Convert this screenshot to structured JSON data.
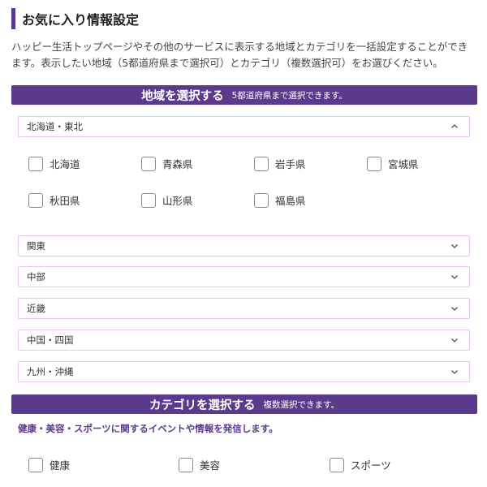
{
  "page": {
    "title": "お気に入り情報設定",
    "intro": "ハッピー生活トップページやその他のサービスに表示する地域とカテゴリを一括設定することができます。表示したい地域（5都道府県まで選択可）とカテゴリ（複数選択可）をお選びください。"
  },
  "region_section": {
    "title": "地域を選択する",
    "note": "5都道府県まで選択できます。"
  },
  "regions": {
    "hokkaido_tohoku": {
      "label": "北海道・東北",
      "expanded": true,
      "prefectures": [
        "北海道",
        "青森県",
        "岩手県",
        "宮城県",
        "秋田県",
        "山形県",
        "福島県"
      ]
    },
    "kanto": {
      "label": "関東"
    },
    "chubu": {
      "label": "中部"
    },
    "kinki": {
      "label": "近畿"
    },
    "chugoku_shikoku": {
      "label": "中国・四国"
    },
    "kyushu_okinawa": {
      "label": "九州・沖縄"
    }
  },
  "category_section": {
    "title": "カテゴリを選択する",
    "note": "複数選択できます。",
    "description": "健康・美容・スポーツに関するイベントや情報を発信します。",
    "categories": [
      "健康",
      "美容",
      "スポーツ"
    ]
  },
  "icons": {
    "chevron_up": "chevron-up-icon",
    "chevron_down": "chevron-down-icon",
    "checkbox": "checkbox-unchecked"
  },
  "colors": {
    "accent": "#5b3a8c",
    "accordion_border": "#e8c8ee",
    "checkbox_border": "#8a8a8a"
  }
}
